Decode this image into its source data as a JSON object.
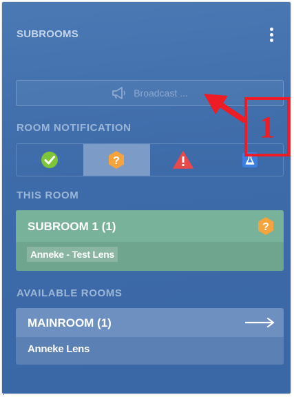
{
  "panel": {
    "title": "SUBROOMS",
    "menu_icon": "kebab-menu-icon"
  },
  "broadcast": {
    "label": "Broadcast ...",
    "icon": "megaphone-icon",
    "state": "disabled"
  },
  "room_notification": {
    "label": "ROOM NOTIFICATION",
    "options": [
      {
        "icon": "check-circle-icon",
        "color": "#7ec637"
      },
      {
        "icon": "question-hexagon-icon",
        "color": "#f5a33c",
        "selected": true
      },
      {
        "icon": "warning-triangle-icon",
        "color": "#e8494b"
      },
      {
        "icon": "flask-icon",
        "color": "#3d7fe0"
      }
    ]
  },
  "this_room": {
    "label": "THIS ROOM",
    "room": {
      "name": "SUBROOM 1 (1)",
      "status_icon": "question-hexagon-icon",
      "members": [
        "Anneke - Test Lens"
      ]
    }
  },
  "available_rooms": {
    "label": "AVAILABLE ROOMS",
    "rooms": [
      {
        "name": "MAINROOM (1)",
        "action_icon": "arrow-right-icon",
        "members": [
          "Anneke Lens"
        ]
      }
    ]
  },
  "annotation": {
    "number": "1",
    "color": "#ee1c24"
  }
}
